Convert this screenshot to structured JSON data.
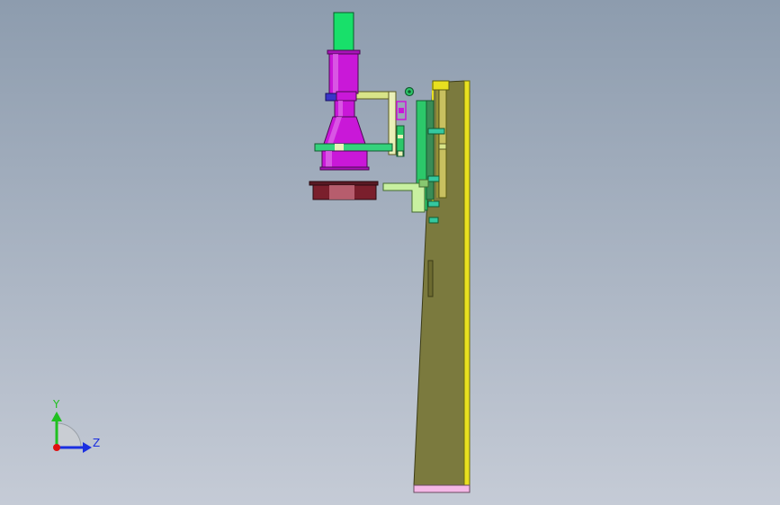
{
  "viewport": {
    "background_top": "#8d9cae",
    "background_bottom": "#c5cbd6"
  },
  "triad": {
    "y_label": "Y",
    "z_label": "Z",
    "y_color": "#20c020",
    "z_color": "#1a2ee0",
    "x_color": "#e01010"
  },
  "model": {
    "colors": {
      "motor": "#18e06a",
      "cylinder": "#c918d8",
      "bracket": "#d8e488",
      "plate": "#2cc86a",
      "column": "#7b7a3e",
      "column_edge": "#e8e020",
      "base": "#f4b8e6",
      "disc": "#7a1f2c",
      "flange_blue": "#3a34c8",
      "clamp": "#34d27c"
    }
  }
}
